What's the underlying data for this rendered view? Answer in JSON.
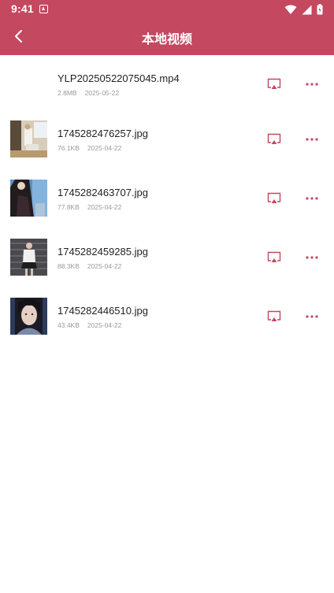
{
  "status_bar": {
    "time": "9:41"
  },
  "header": {
    "title": "本地视频"
  },
  "colors": {
    "accent": "#c4485f",
    "text": "#222222",
    "meta": "#9a9a9a"
  },
  "files": [
    {
      "name": "YLP20250522075045.mp4",
      "size": "2.8MB",
      "date": "2025-05-22",
      "thumb": "none"
    },
    {
      "name": "1745282476257.jpg",
      "size": "76.1KB",
      "date": "2025-04-22",
      "thumb": "photo-room"
    },
    {
      "name": "1745282463707.jpg",
      "size": "77.8KB",
      "date": "2025-04-22",
      "thumb": "photo-dark-figure"
    },
    {
      "name": "1745282459285.jpg",
      "size": "88.3KB",
      "date": "2025-04-22",
      "thumb": "photo-rooftop"
    },
    {
      "name": "1745282446510.jpg",
      "size": "43.4KB",
      "date": "2025-04-22",
      "thumb": "photo-portrait"
    }
  ],
  "icons": {
    "back": "chevron-left-icon",
    "cast": "screen-cast-icon",
    "more": "more-dots-icon"
  }
}
